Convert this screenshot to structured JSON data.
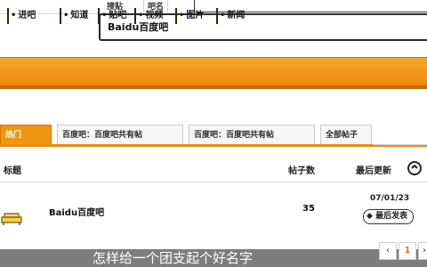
{
  "top_tabs": [
    "搜贴",
    "吧名"
  ],
  "search": {
    "value": "Baidu百度吧"
  },
  "nav": [
    "进吧",
    "知道",
    "贴吧",
    "视频",
    "图片",
    "新闻"
  ],
  "tabs": [
    {
      "label": "热门",
      "active": true
    },
    {
      "label": "百度吧：百度吧共有帖",
      "active": false
    },
    {
      "label": "百度吧：百度吧共有帖",
      "active": false
    },
    {
      "label": "全部帖子",
      "active": false
    }
  ],
  "table": {
    "headers": [
      "标题",
      "帖子数",
      "最后更新"
    ],
    "row": {
      "name": "Baidu百度吧",
      "count": "35",
      "date": "07/01/23",
      "badge": "最后发表"
    }
  },
  "pager": {
    "prev": "‹",
    "current": "1",
    "next": "›"
  },
  "bottom_bar": "怎样给一个团支起个好名字"
}
